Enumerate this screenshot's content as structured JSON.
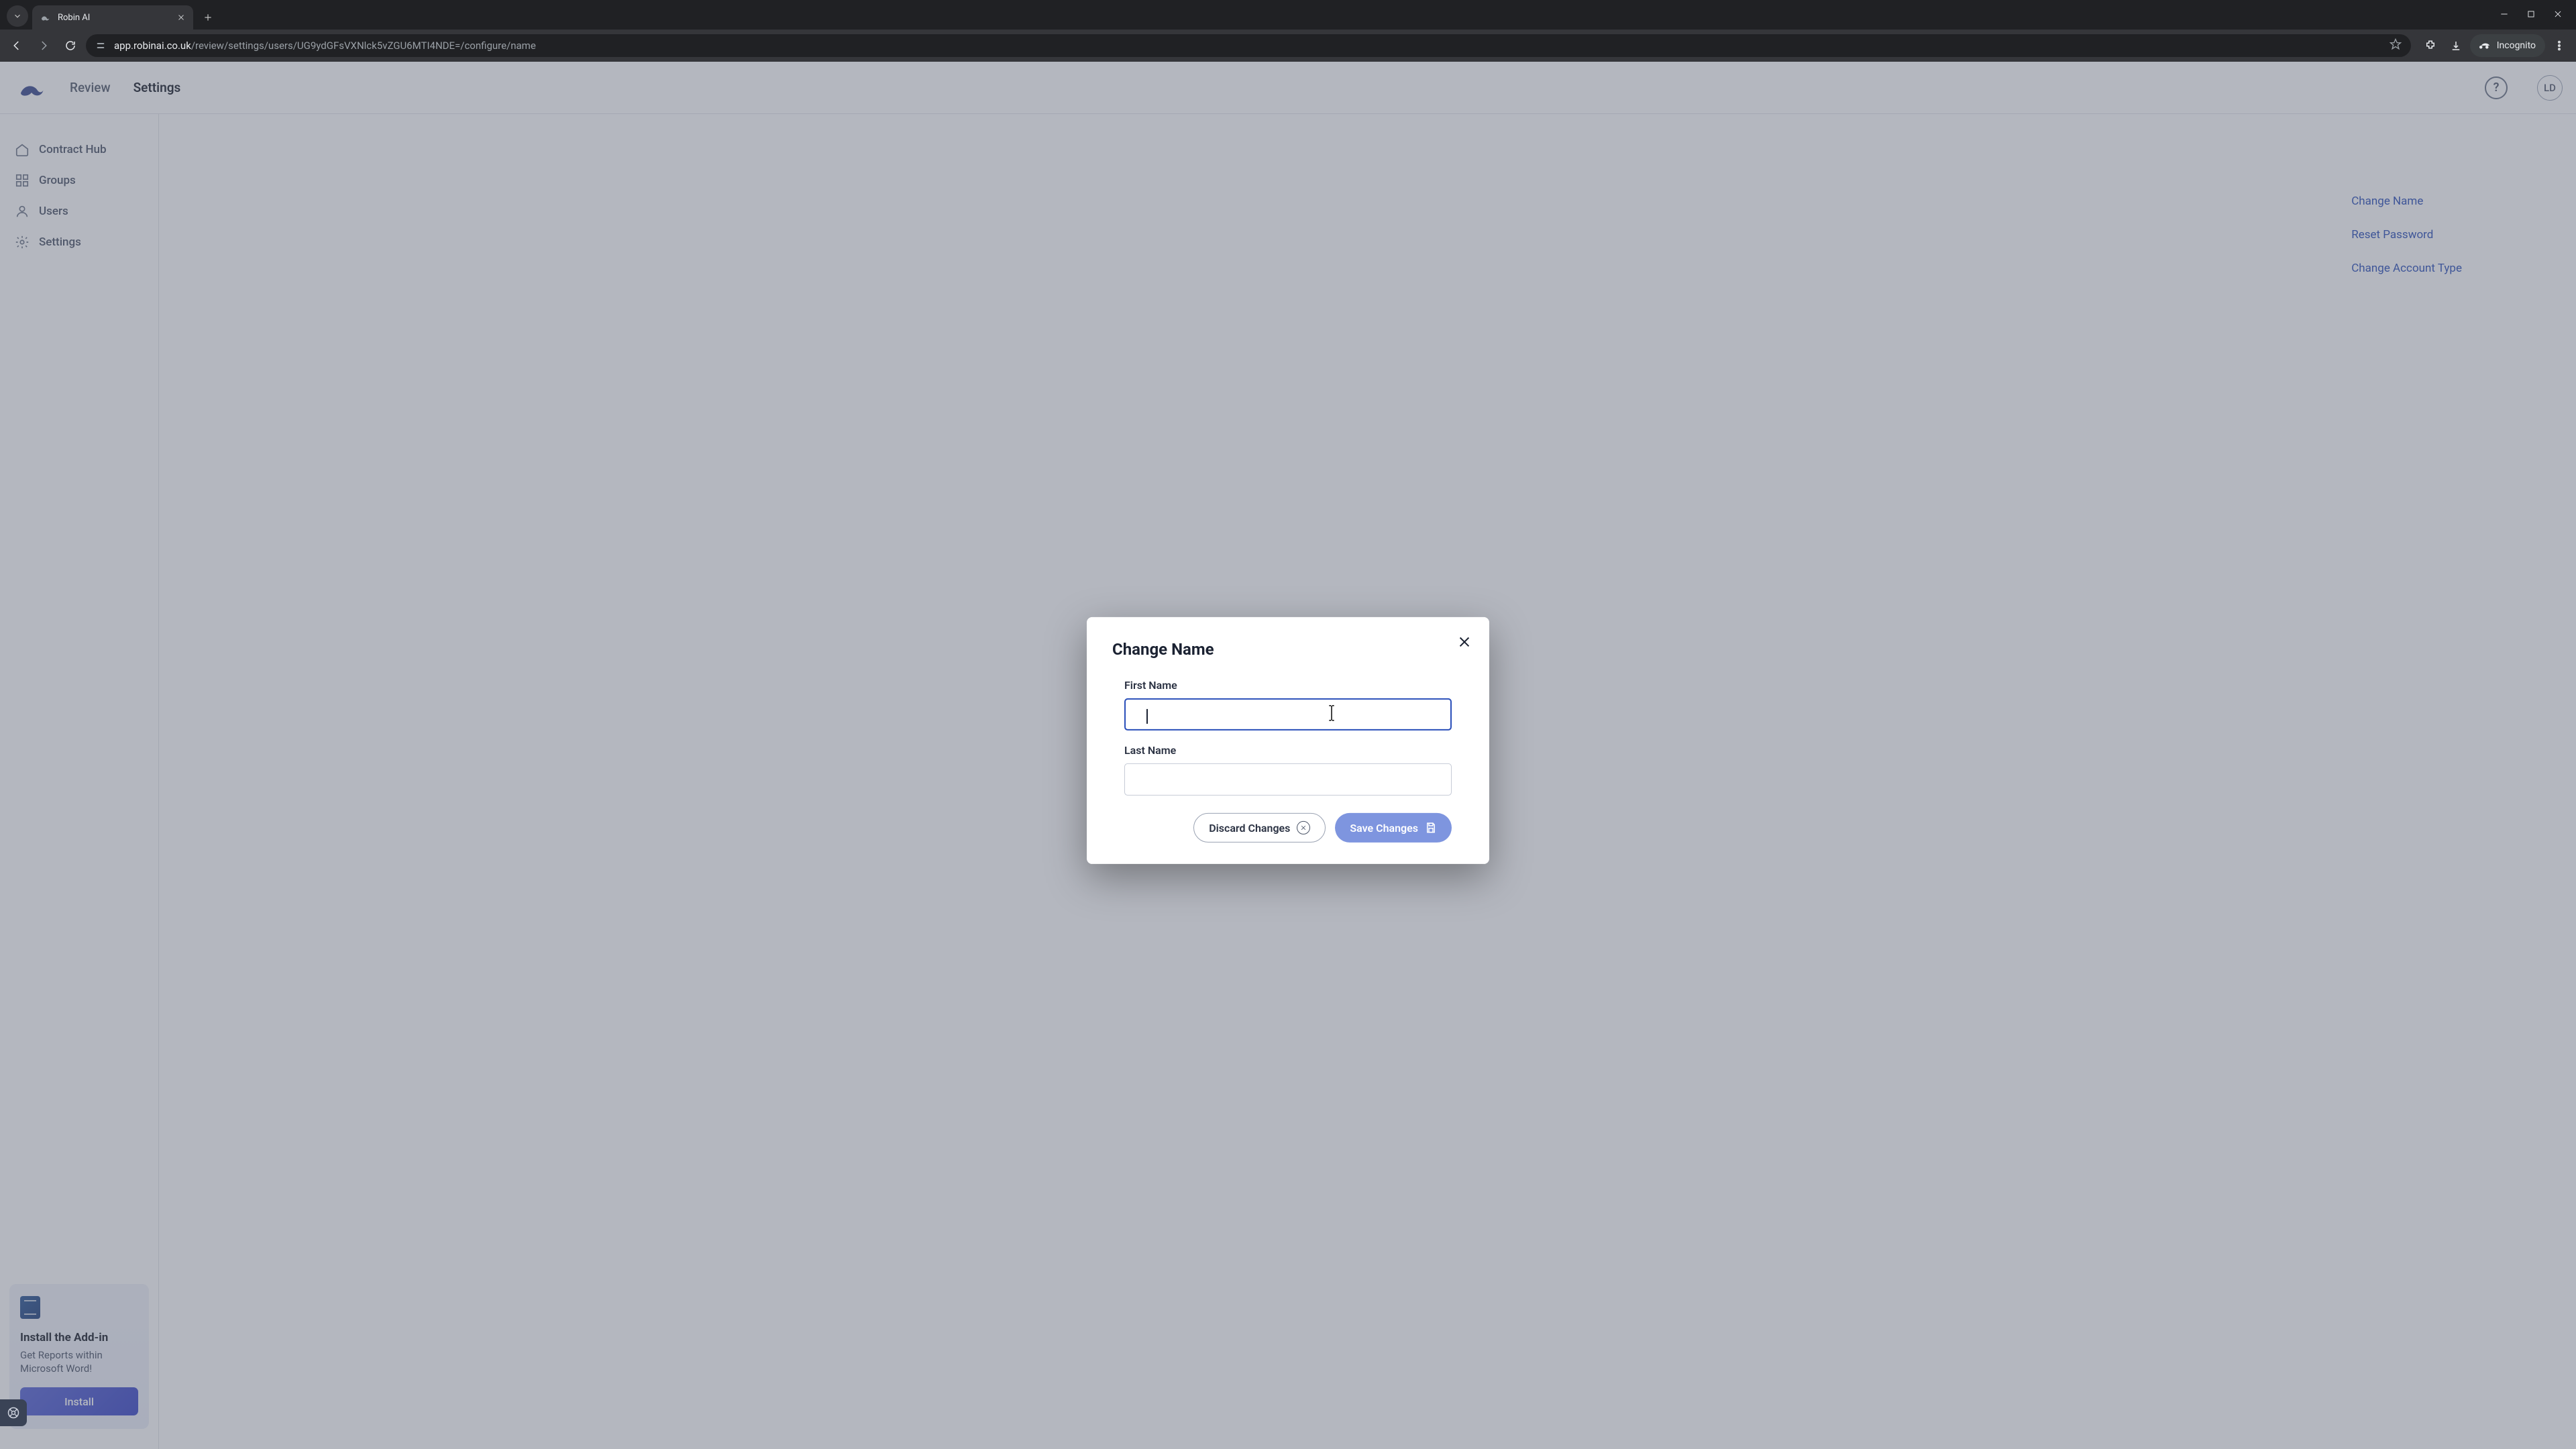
{
  "browser": {
    "tab_title": "Robin AI",
    "url_host": "app.robinai.co.uk",
    "url_path": "/review/settings/users/UG9ydGFsVXNlck5vZGU6MTI4NDE=/configure/name",
    "incognito_label": "Incognito"
  },
  "header": {
    "nav": {
      "review": "Review",
      "settings": "Settings"
    },
    "avatar_initials": "LD"
  },
  "sidebar": {
    "items": [
      {
        "label": "Contract Hub"
      },
      {
        "label": "Groups"
      },
      {
        "label": "Users"
      },
      {
        "label": "Settings"
      }
    ],
    "addin": {
      "title": "Install the Add-in",
      "body": "Get Reports within Microsoft Word!",
      "cta": "Install"
    }
  },
  "background_links": {
    "change_name": "Change Name",
    "reset_password": "Reset Password",
    "change_account_type": "Change Account Type"
  },
  "modal": {
    "title": "Change Name",
    "first_name_label": "First Name",
    "first_name_value": "",
    "last_name_label": "Last Name",
    "last_name_value": "",
    "discard": "Discard Changes",
    "save": "Save Changes"
  }
}
